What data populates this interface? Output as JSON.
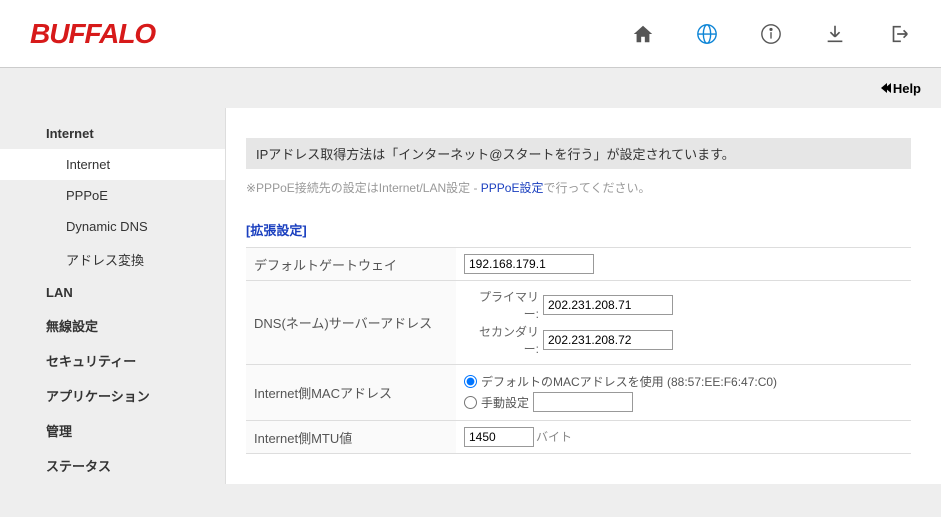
{
  "logo": "BUFFALO",
  "help_label": "Help",
  "sidebar": {
    "items": [
      {
        "label": "Internet",
        "bold": true
      },
      {
        "label": "Internet",
        "sub": true,
        "active": true
      },
      {
        "label": "PPPoE",
        "sub": true
      },
      {
        "label": "Dynamic DNS",
        "sub": true
      },
      {
        "label": "アドレス変換",
        "sub": true
      },
      {
        "label": "LAN",
        "bold": true
      },
      {
        "label": "無線設定",
        "bold": true
      },
      {
        "label": "セキュリティー",
        "bold": true
      },
      {
        "label": "アプリケーション",
        "bold": true
      },
      {
        "label": "管理",
        "bold": true
      },
      {
        "label": "ステータス",
        "bold": true
      }
    ]
  },
  "main": {
    "info_banner": "IPアドレス取得方法は「インターネット@スタートを行う」が設定されています。",
    "note_prefix": "※PPPoE接続先の設定はInternet/LAN設定 - ",
    "note_link": "PPPoE設定",
    "note_suffix": "で行ってください。",
    "section_title": "[拡張設定]",
    "rows": {
      "gateway": {
        "label": "デフォルトゲートウェイ",
        "value": "192.168.179.1"
      },
      "dns": {
        "label": "DNS(ネーム)サーバーアドレス",
        "primary_label": "プライマリー:",
        "primary_value": "202.231.208.71",
        "secondary_label": "セカンダリー:",
        "secondary_value": "202.231.208.72"
      },
      "mac": {
        "label": "Internet側MACアドレス",
        "opt_default": "デフォルトのMACアドレスを使用 (88:57:EE:F6:47:C0)",
        "opt_manual": "手動設定",
        "manual_value": ""
      },
      "mtu": {
        "label": "Internet側MTU値",
        "value": "1450",
        "unit": "バイト"
      }
    }
  }
}
